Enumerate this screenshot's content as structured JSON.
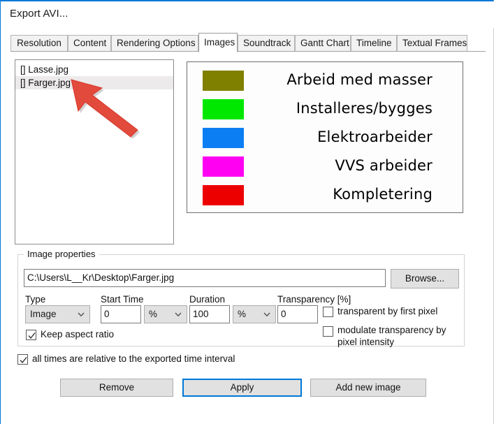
{
  "window": {
    "title": "Export AVI...",
    "accent_color": "#0078d7"
  },
  "tabs": [
    {
      "label": "Resolution",
      "selected": false
    },
    {
      "label": "Content",
      "selected": false
    },
    {
      "label": "Rendering Options",
      "selected": false
    },
    {
      "label": "Images",
      "selected": true
    },
    {
      "label": "Soundtrack",
      "selected": false
    },
    {
      "label": "Gantt Chart",
      "selected": false
    },
    {
      "label": "Timeline",
      "selected": false
    },
    {
      "label": "Textual Frames",
      "selected": false
    }
  ],
  "file_list": {
    "items": [
      {
        "label": "[] Lasse.jpg",
        "selected": false
      },
      {
        "label": "[] Farger.jpg",
        "selected": true
      }
    ]
  },
  "preview": {
    "legend": [
      {
        "label": "Arbeid med masser",
        "color": "#808000"
      },
      {
        "label": "Installeres/bygges",
        "color": "#00e800"
      },
      {
        "label": "Elektroarbeider",
        "color": "#0b7ef4"
      },
      {
        "label": "VVS arbeider",
        "color": "#ff00f2"
      },
      {
        "label": "Kompletering",
        "color": "#ed0000"
      }
    ]
  },
  "annotation": {
    "arrow_color": "#e24a3c",
    "points_to": "[] Farger.jpg"
  },
  "image_properties": {
    "group_label": "Image properties",
    "path_value": "C:\\Users\\L__Kr\\Desktop\\Farger.jpg",
    "browse_label": "Browse...",
    "type": {
      "label": "Type",
      "value": "Image"
    },
    "start_time": {
      "label": "Start Time",
      "value": "0",
      "unit": "%"
    },
    "duration": {
      "label": "Duration",
      "value": "100",
      "unit": "%"
    },
    "transparency": {
      "label": "Transparency [%]",
      "value": "0"
    },
    "keep_aspect_ratio": {
      "label": "Keep aspect ratio",
      "checked": true
    },
    "transparent_by_first_pixel": {
      "label": "transparent by first pixel",
      "checked": false
    },
    "modulate_transparency": {
      "label": "modulate transparency by pixel intensity",
      "checked": false
    }
  },
  "footer": {
    "all_times_relative": {
      "label": "all times are relative to the exported time interval",
      "checked": true
    },
    "buttons": {
      "remove": "Remove",
      "apply": "Apply",
      "add_new_image": "Add new image"
    }
  }
}
